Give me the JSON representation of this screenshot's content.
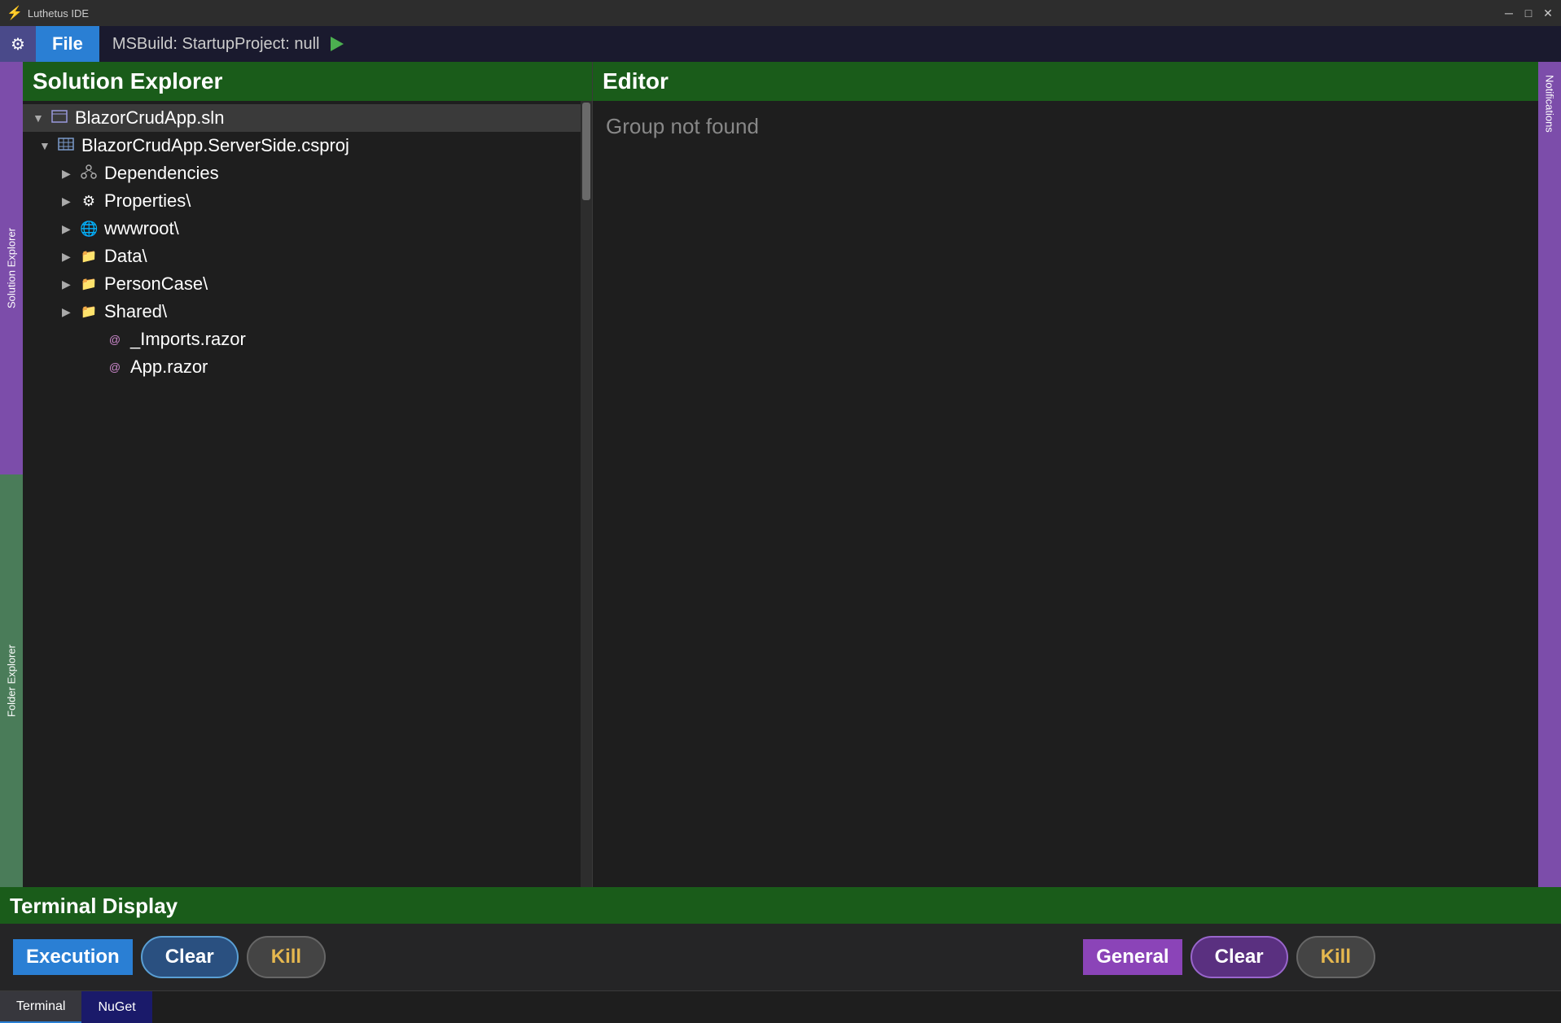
{
  "window": {
    "title": "Luthetus IDE",
    "logo": "⚡"
  },
  "titlebar": {
    "minimize": "─",
    "maximize": "□",
    "close": "✕"
  },
  "menubar": {
    "gear_icon": "⚙",
    "file_label": "File",
    "project_label": "MSBuild: StartupProject:  null",
    "run_icon": "▶"
  },
  "sidebar": {
    "solution_explorer_tab": "Solution Explorer",
    "folder_explorer_tab": "Folder Explorer"
  },
  "solution_explorer": {
    "header": "Solution Explorer",
    "items": [
      {
        "id": "sln",
        "level": "root",
        "icon": "sln",
        "label": "BlazorCrudApp.sln",
        "expanded": true,
        "chevron": "▼"
      },
      {
        "id": "csproj",
        "level": "1",
        "icon": "csproj",
        "label": "BlazorCrudApp.ServerSide.csproj",
        "expanded": true,
        "chevron": "▼"
      },
      {
        "id": "dependencies",
        "level": "2",
        "icon": "deps",
        "label": "Dependencies",
        "expanded": false,
        "chevron": "▶"
      },
      {
        "id": "properties",
        "level": "2",
        "icon": "gear",
        "label": "Properties\\",
        "expanded": false,
        "chevron": "▶"
      },
      {
        "id": "wwwroot",
        "level": "2",
        "icon": "globe",
        "label": "wwwroot\\",
        "expanded": false,
        "chevron": "▶"
      },
      {
        "id": "data",
        "level": "2",
        "icon": "folder",
        "label": "Data\\",
        "expanded": false,
        "chevron": "▶"
      },
      {
        "id": "personcase",
        "level": "2",
        "icon": "folder",
        "label": "PersonCase\\",
        "expanded": false,
        "chevron": "▶"
      },
      {
        "id": "shared",
        "level": "2",
        "icon": "folder",
        "label": "Shared\\",
        "expanded": false,
        "chevron": "▶"
      },
      {
        "id": "imports",
        "level": "3",
        "icon": "at",
        "label": "_Imports.razor",
        "expanded": false,
        "chevron": ""
      },
      {
        "id": "app",
        "level": "3",
        "icon": "at",
        "label": "App.razor",
        "expanded": false,
        "chevron": ""
      }
    ]
  },
  "editor": {
    "header": "Editor",
    "content": "Group not found"
  },
  "notifications_tab": "Notifications",
  "terminal": {
    "header": "Terminal Display",
    "execution_label": "Execution",
    "clear_execution_label": "Clear",
    "kill_execution_label": "Kill",
    "general_label": "General",
    "clear_general_label": "Clear",
    "kill_general_label": "Kill",
    "tabs": [
      {
        "id": "terminal",
        "label": "Terminal",
        "active": true
      },
      {
        "id": "nuget",
        "label": "NuGet",
        "active": false
      }
    ]
  }
}
